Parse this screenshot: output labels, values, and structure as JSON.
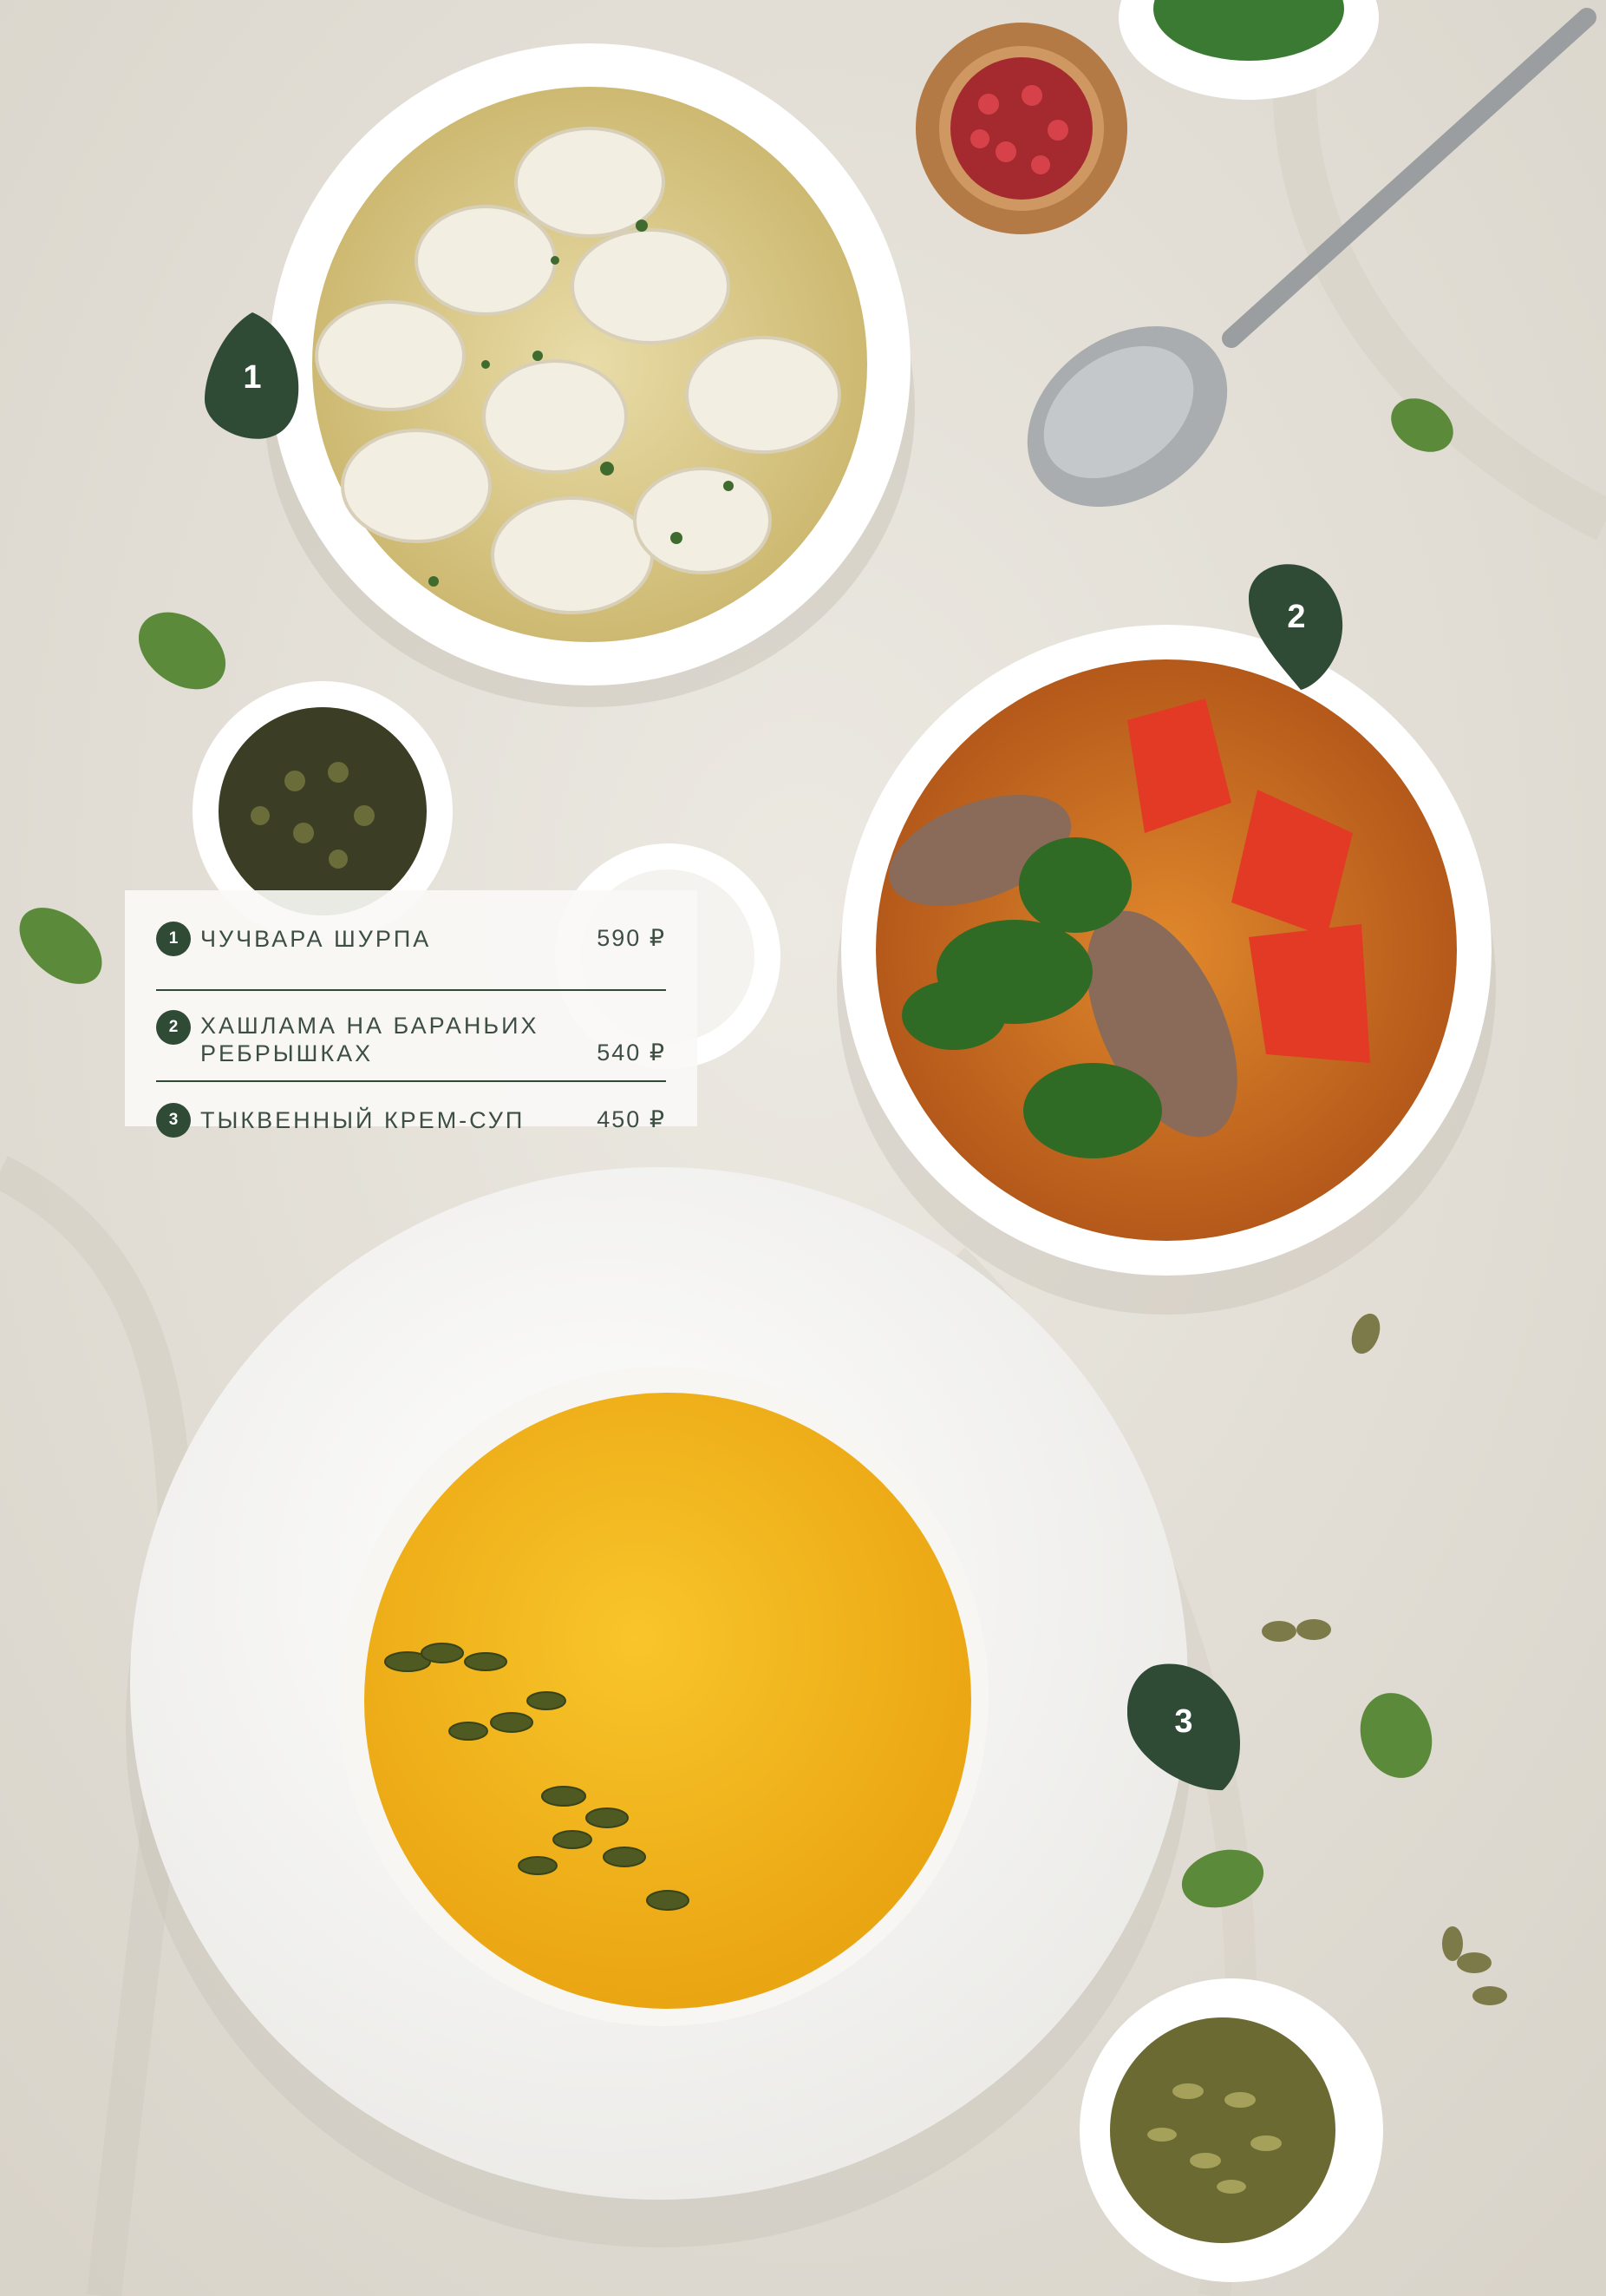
{
  "menu": {
    "items": [
      {
        "number": "1",
        "name": "ЧУЧВАРА ШУРПА",
        "price": "590 ₽"
      },
      {
        "number": "2",
        "name_line1": "ХАШЛАМА НА БАРАНЬИХ",
        "name_line2": "РЕБРЫШКАХ",
        "price": "540 ₽"
      },
      {
        "number": "3",
        "name": "ТЫКВЕННЫЙ КРЕМ-СУП",
        "price": "450 ₽"
      }
    ]
  },
  "markers": [
    "1",
    "2",
    "3"
  ],
  "colors": {
    "accent": "#2f4a35",
    "menu_text": "#3d4f42",
    "tablecloth": "#e6e2da",
    "pumpkin_soup": "#f2b41c",
    "broth": "#e6d79e",
    "tomato_soup": "#d9731f"
  }
}
